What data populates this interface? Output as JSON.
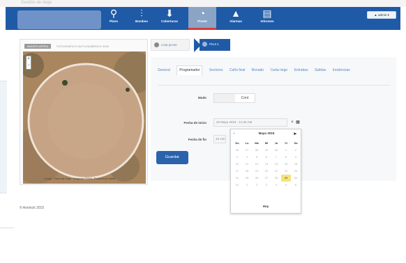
{
  "window": {
    "top_text": "Gestión de riego"
  },
  "nav": {
    "items": [
      {
        "label": "Plano",
        "icon": "⚲"
      },
      {
        "label": "Bombeo",
        "icon": "⫶"
      },
      {
        "label": "Coberturas",
        "icon": "⬇"
      },
      {
        "label": "Pivote",
        "icon": "◔"
      },
      {
        "label": "Alarmas",
        "icon": "▲"
      },
      {
        "label": "Informes",
        "icon": "▤"
      }
    ],
    "admin_label": "▲ admin ▾"
  },
  "map": {
    "tab_active": "IMAGEN AÉREA",
    "tab_other": "TOPOGRÁFICO MUTO-NUMÉRICO 3000",
    "footer": "Google · Datos del mapa · Imágenes ©2015 · Powered by Leaflet",
    "zoom_in": "+",
    "zoom_out": "−"
  },
  "breadcrumb": {
    "list_label": "Lista pivote",
    "current_label": "Pivot 1"
  },
  "tabs": [
    "General",
    "Programador",
    "Sectores",
    "Caño final",
    "Bonado",
    "Carta riego",
    "Entradas",
    "Salidas",
    "Incidencias"
  ],
  "form": {
    "modo_label": "Modo",
    "modo_value": "Cont",
    "inicio_label": "Fecha de inicio",
    "inicio_value": "20 Mayo 2015 - 11:32 AM",
    "fin_label": "Fecha de fin",
    "fin_value": "16 Jun",
    "clear_icon": "×",
    "calendar_icon": "▦",
    "save_label": "Guardar"
  },
  "calendar": {
    "month": "Mayo 2015",
    "prev": "‹",
    "next": "▸",
    "weekdays": [
      "Do",
      "Lu",
      "Ma",
      "Mi",
      "Ju",
      "Vi",
      "Sa"
    ],
    "weeks": [
      [
        "26",
        "27",
        "28",
        "29",
        "30",
        "1",
        "2"
      ],
      [
        "3",
        "4",
        "5",
        "6",
        "7",
        "8",
        "9"
      ],
      [
        "10",
        "11",
        "12",
        "13",
        "14",
        "15",
        "16"
      ],
      [
        "17",
        "18",
        "19",
        "20",
        "21",
        "22",
        "23"
      ],
      [
        "24",
        "25",
        "26",
        "27",
        "28",
        "29",
        "30"
      ],
      [
        "31",
        "1",
        "2",
        "3",
        "4",
        "5",
        "6"
      ]
    ],
    "today_label": "Hoy"
  },
  "footer": {
    "copyright": "© Anelock 2015"
  }
}
